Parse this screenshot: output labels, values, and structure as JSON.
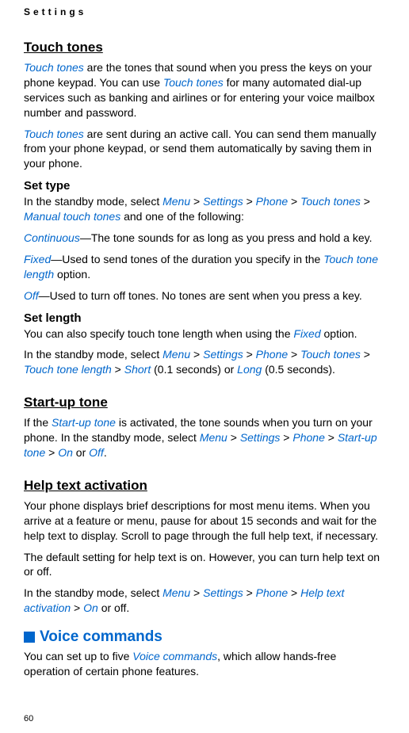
{
  "header": {
    "title": "Settings"
  },
  "touch_tones": {
    "heading": "Touch tones",
    "intro_part1": "Touch tones",
    "intro_part2": " are the tones that sound when you press the keys on your phone keypad. You can use ",
    "intro_part3": "Touch tones",
    "intro_part4": " for many automated dial-up services such as banking and airlines or for entering your voice mailbox number and password.",
    "sent_part1": "Touch tones",
    "sent_part2": " are sent during an active call. You can send them manually from your phone keypad, or send them automatically by saving them in your phone."
  },
  "set_type": {
    "heading": "Set type",
    "intro_part1": "In the standby mode, select ",
    "menu": "Menu",
    "gt1": " > ",
    "settings": "Settings",
    "gt2": " > ",
    "phone": "Phone",
    "gt3": " > ",
    "touch_tones": "Touch tones",
    "gt4": " > ",
    "manual_touch_tones": "Manual touch tones",
    "intro_part2": " and one of the following:",
    "continuous_label": "Continuous",
    "continuous_desc": "—The tone sounds for as long as you press and hold a key.",
    "fixed_label": "Fixed",
    "fixed_desc1": "—Used to send tones of the duration you specify in the ",
    "touch_tone_length": "Touch tone length",
    "fixed_desc2": " option.",
    "off_label": "Off",
    "off_desc": "—Used to turn off tones. No tones are sent when you press a key."
  },
  "set_length": {
    "heading": "Set length",
    "intro_part1": "You can also specify touch tone length when using the ",
    "fixed": "Fixed",
    "intro_part2": " option.",
    "standby_part1": "In the standby mode, select ",
    "menu": "Menu",
    "gt1": " > ",
    "settings": "Settings",
    "gt2": " > ",
    "phone": "Phone",
    "gt3": " > ",
    "touch_tones": "Touch tones",
    "gt4": " > ",
    "touch_tone_length": "Touch tone length",
    "gt5": " > ",
    "short": "Short",
    "short_desc": " (0.1 seconds) or ",
    "long": "Long",
    "long_desc": " (0.5 seconds)."
  },
  "startup_tone": {
    "heading": "Start-up tone",
    "intro_part1": "If the ",
    "startup_tone": "Start-up tone",
    "intro_part2": " is activated, the tone sounds when you turn on your phone. In the standby mode, select ",
    "menu": "Menu",
    "gt1": " > ",
    "settings": "Settings",
    "gt2": " > ",
    "phone": "Phone",
    "gt3": " > ",
    "startup_tone2": "Start-up tone",
    "gt4": " > ",
    "on": "On",
    "or": " or ",
    "off": "Off",
    "period": "."
  },
  "help_text": {
    "heading": "Help text activation",
    "para1": "Your phone displays brief descriptions for most menu items. When you arrive at a feature or menu, pause for about 15 seconds and wait for the help text to display. Scroll to page through the full help text, if necessary.",
    "para2": "The default setting for help text is on. However, you can turn help text on or off.",
    "standby_part1": "In the standby mode, select ",
    "menu": "Menu",
    "gt1": " > ",
    "settings": "Settings",
    "gt2": " > ",
    "phone": "Phone",
    "gt3": " > ",
    "help_text_activation": "Help text activation",
    "gt4": " > ",
    "on": "On",
    "off_text": " or off."
  },
  "voice_commands": {
    "heading": "Voice commands",
    "intro_part1": "You can set up to five ",
    "voice_commands": "Voice commands",
    "intro_part2": ", which allow hands-free operation of certain phone features."
  },
  "page_number": "60"
}
